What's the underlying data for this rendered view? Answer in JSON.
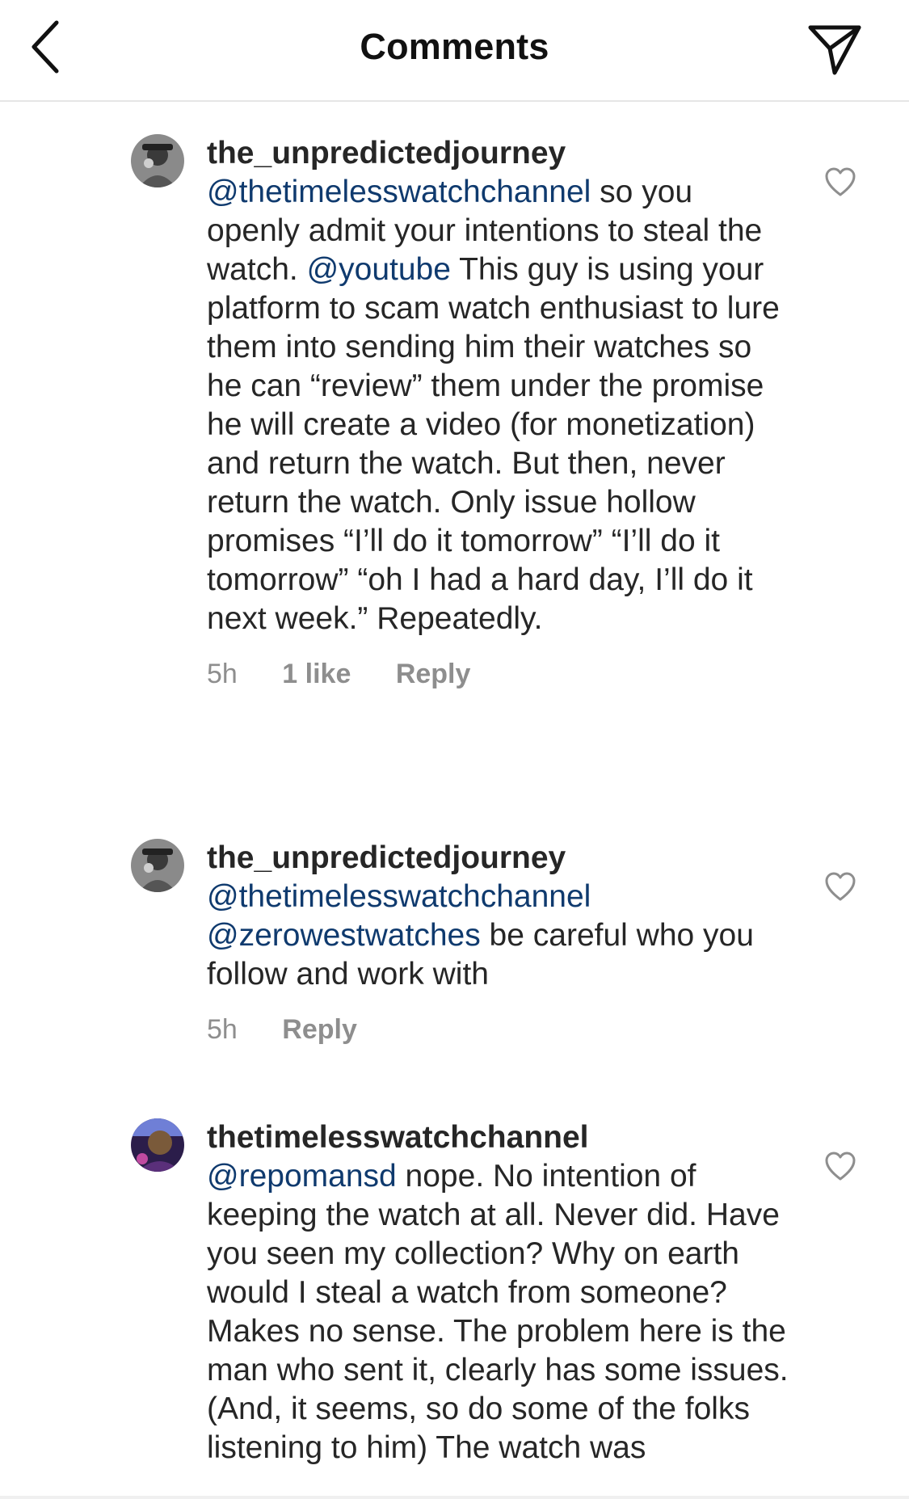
{
  "header": {
    "title": "Comments",
    "back_icon": "chevron-left-icon",
    "send_icon": "paper-plane-icon"
  },
  "comments": [
    {
      "username": "the_unpredictedjourney",
      "segments": [
        {
          "type": "mention",
          "text": "@thetimelesswatchchannel"
        },
        {
          "type": "text",
          "text": " so you openly admit your intentions to steal the watch. "
        },
        {
          "type": "mention",
          "text": "@youtube"
        },
        {
          "type": "text",
          "text": " This guy is using your platform to scam watch enthusiast to lure them into sending him their watches so he can “review” them under the promise he will create a video (for monetization) and return the watch. But then, never return the watch. Only issue hollow promises “I’ll do it tomorrow” “I’ll do it tomorrow” “oh I had a hard day, I’ll do it next week.” Repeatedly."
        }
      ],
      "time": "5h",
      "likes": "1 like",
      "reply": "Reply"
    },
    {
      "username": "the_unpredictedjourney",
      "segments": [
        {
          "type": "mention",
          "text": "@thetimelesswatchchannel"
        },
        {
          "type": "text",
          "text": " "
        },
        {
          "type": "mention",
          "text": "@zerowestwatches"
        },
        {
          "type": "text",
          "text": " be careful who you follow and work with"
        }
      ],
      "time": "5h",
      "likes": "",
      "reply": "Reply"
    },
    {
      "username": "thetimelesswatchchannel",
      "segments": [
        {
          "type": "mention",
          "text": "@repomansd"
        },
        {
          "type": "text",
          "text": " nope. No intention of keeping the watch at all. Never did. Have you seen my collection? Why on earth would I steal a watch from someone? Makes no sense. The problem here is the man who sent it, clearly has some issues. (And, it seems, so do some of the folks listening to him) The watch was"
        }
      ],
      "time": "",
      "likes": "",
      "reply": ""
    }
  ],
  "colors": {
    "mention": "#0f3a6e",
    "meta": "#8e8e8e",
    "text": "#262626"
  }
}
